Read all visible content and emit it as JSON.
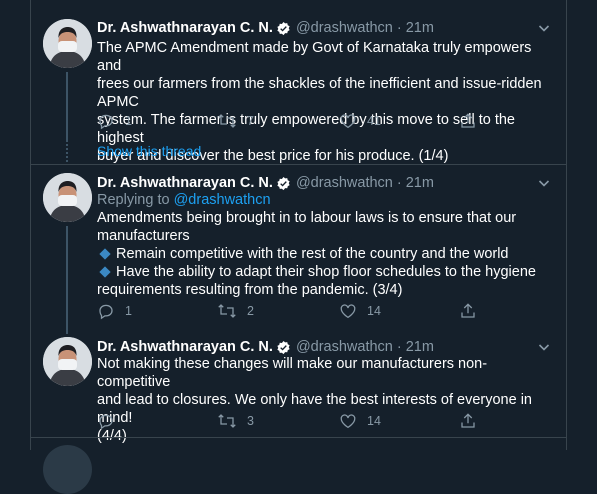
{
  "tweets": [
    {
      "name": "Dr. Ashwathnarayan C. N.",
      "handle": "@drashwathcn",
      "time": "21m",
      "text": [
        "The APMC Amendment made by Govt of Karnataka truly empowers and",
        "frees our farmers from the shackles of the inefficient and issue-ridden APMC",
        "system. The farmer is truly empowered by this move to sell to the highest",
        "buyer and discover the best price for his produce. (1/4)"
      ],
      "replies": "1",
      "retweets": "7",
      "likes": "41"
    },
    {
      "name": "Dr. Ashwathnarayan C. N.",
      "handle": "@drashwathcn",
      "time": "21m",
      "replying_to_label": "Replying to",
      "replying_to_handle": "@drashwathcn",
      "text": [
        "Amendments being brought in to labour laws is to ensure that our",
        "manufacturers"
      ],
      "bullets": [
        "Remain competitive with the rest of the country and the world",
        "Have the ability to adapt their shop floor schedules to the hygiene"
      ],
      "text_tail": "requirements resulting from the pandemic. (3/4)",
      "replies": "1",
      "retweets": "2",
      "likes": "14"
    },
    {
      "name": "Dr. Ashwathnarayan C. N.",
      "handle": "@drashwathcn",
      "time": "21m",
      "text": [
        "Not making these changes will make our manufacturers non-competitive",
        "and lead to closures. We only have the best interests of everyone in mind!",
        "(4/4)"
      ],
      "retweets": "3",
      "likes": "14"
    }
  ],
  "show_thread_label": "Show this thread",
  "separator": "·",
  "colors": {
    "background": "#15202b",
    "border": "#38444d",
    "accent": "#1da1f2",
    "secondary_text": "#8899a6"
  },
  "icons": {
    "verified": "verified-badge-icon",
    "caret": "chevron-down-icon",
    "reply": "reply-icon",
    "retweet": "retweet-icon",
    "like": "heart-icon",
    "share": "share-icon"
  }
}
